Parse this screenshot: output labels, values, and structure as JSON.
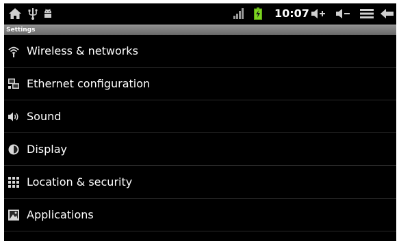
{
  "status_bar": {
    "time": "10:07",
    "left_icons": [
      "home-icon",
      "usb-icon",
      "android-debug-icon"
    ],
    "right_icons": [
      "signal-icon",
      "battery-charging-icon",
      "volume-up-icon",
      "volume-down-icon",
      "menu-icon",
      "back-icon"
    ],
    "battery_color": "#7bd321"
  },
  "header": {
    "title": "Settings"
  },
  "settings_list": {
    "items": [
      {
        "label": "Wireless & networks",
        "icon": "wifi-icon"
      },
      {
        "label": "Ethernet configuration",
        "icon": "ethernet-icon"
      },
      {
        "label": "Sound",
        "icon": "speaker-icon"
      },
      {
        "label": "Display",
        "icon": "brightness-icon"
      },
      {
        "label": "Location & security",
        "icon": "location-grid-icon"
      },
      {
        "label": "Applications",
        "icon": "applications-icon"
      }
    ]
  },
  "colors": {
    "background": "#000000",
    "title_bar": "#7c7c7c",
    "text": "#ffffff",
    "divider": "#2b2b2b"
  }
}
